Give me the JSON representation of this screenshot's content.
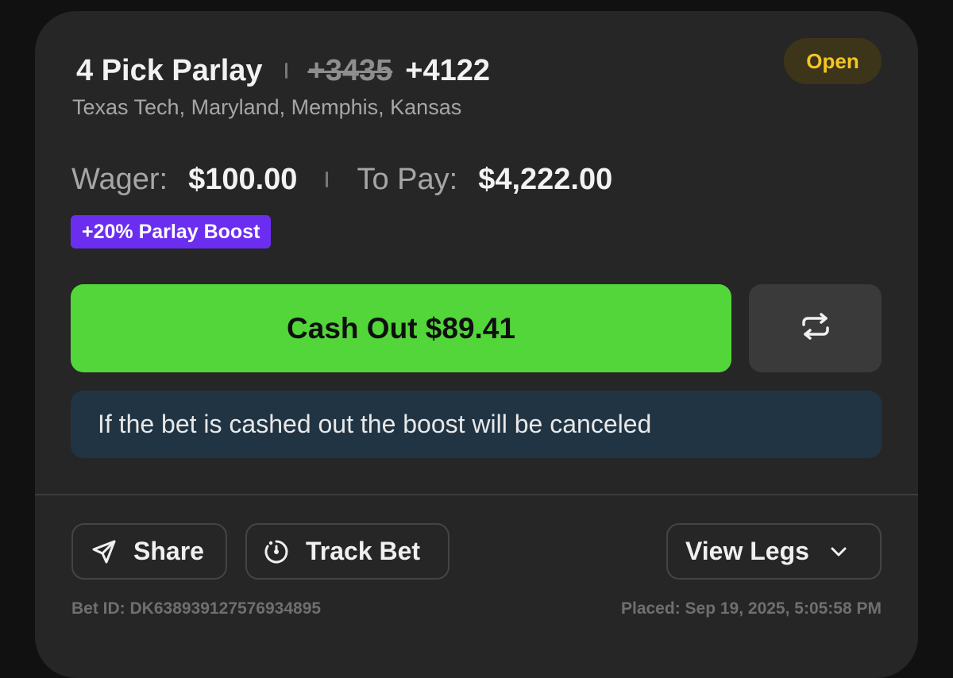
{
  "bet": {
    "title": "4 Pick Parlay",
    "old_odds": "+3435",
    "new_odds": "+4122",
    "teams": "Texas Tech, Maryland, Memphis, Kansas",
    "status": "Open"
  },
  "wager": {
    "wager_label": "Wager:",
    "wager_value": "$100.00",
    "topay_label": "To Pay:",
    "topay_value": "$4,222.00"
  },
  "boost_label": "+20% Parlay Boost",
  "actions": {
    "cashout_label": "Cash Out $89.41",
    "refresh_icon": "swap-arrows-icon",
    "notice": "If the bet is cashed out the boost will be canceled"
  },
  "footer": {
    "share_label": "Share",
    "track_label": "Track Bet",
    "legs_label": "View Legs",
    "bet_id": "Bet ID: DK638939127576934895",
    "placed": "Placed: Sep 19, 2025, 5:05:58 PM"
  },
  "colors": {
    "accent_green": "#52d63a",
    "boost_purple": "#6b2ef0",
    "status_yellow": "#f3c623",
    "notice_bg": "#203444"
  }
}
